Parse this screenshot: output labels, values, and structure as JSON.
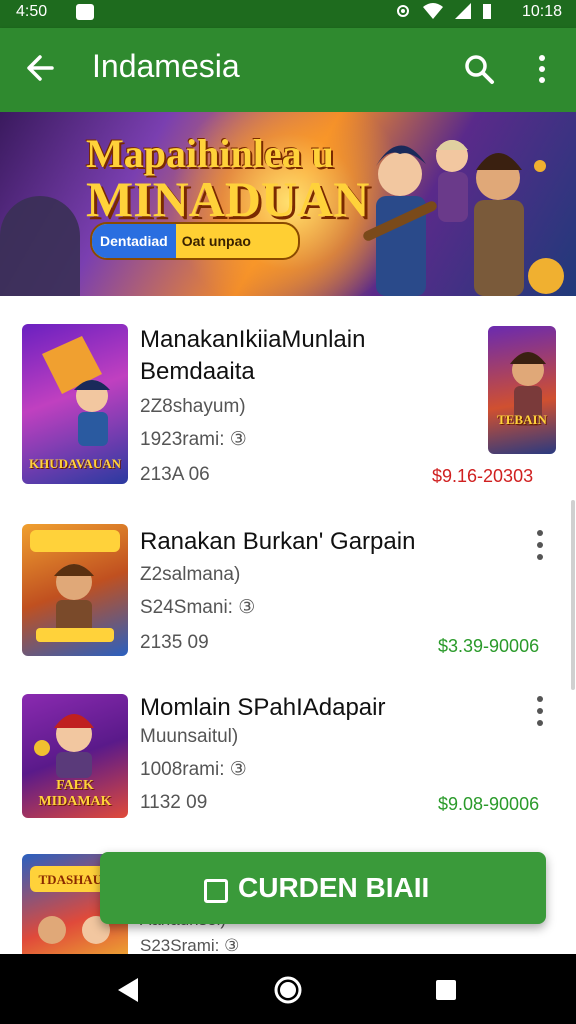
{
  "status_bar": {
    "time_left": "4:50",
    "time_right": "10:18"
  },
  "app_bar": {
    "title": "Indamesia",
    "back_icon": "arrow-left-icon",
    "search_icon": "search-icon",
    "more_icon": "more-vert-icon"
  },
  "banner": {
    "title_line1": "Mapaihinlea u",
    "title_line2": "MINADUAN",
    "pill_left": "Dentadiad",
    "pill_right": "Oat unpao",
    "carousel_total": 3,
    "carousel_active": 1
  },
  "games": [
    {
      "title_line1": "ManakanIkiiaMunlain",
      "title_line2": "Bemdaaita",
      "sub1": "2Z8shayum)",
      "sub2": "1923rami: ③",
      "sub3": "213A 06",
      "price": "$9.16-20303",
      "price_color": "#d02020",
      "thumb_caption": "KHUDAVAUAN",
      "side_thumb_caption": "TEBAIN",
      "colors": [
        "#7a2ad0",
        "#f0a030",
        "#2050c0"
      ]
    },
    {
      "title_line1": "Ranakan Burkan' Garpain",
      "sub1": "Z2salmana)",
      "sub2": "S24Smani: ③",
      "sub3": "2135 09",
      "price": "$3.39-90006",
      "price_color": "#2a9a2a",
      "thumb_caption": "",
      "colors": [
        "#f0a030",
        "#2a60c0",
        "#7a3a1a"
      ]
    },
    {
      "title_line1": "Momlain SPahIAdapair",
      "sub1": "Muunsaitul)",
      "sub2": "1008rami: ③",
      "sub3": "1132 09",
      "price": "$9.08-90006",
      "price_color": "#2a9a2a",
      "thumb_caption": "FAEK MIDAMAK",
      "colors": [
        "#8a2ab0",
        "#e04a3a",
        "#f0c030"
      ]
    },
    {
      "sub1": "Aanaunsel)",
      "sub2": "S23Srami: ③",
      "colors": [
        "#e04a3a",
        "#2a60c0",
        "#f0c030"
      ],
      "thumb_caption": "TDASHAUA"
    }
  ],
  "fab": {
    "label": "CURDEN BIAII",
    "icon": "copy-icon"
  },
  "nav_bar": {
    "back_icon": "triangle-back-icon",
    "home_icon": "circle-home-icon",
    "recents_icon": "square-recents-icon"
  }
}
